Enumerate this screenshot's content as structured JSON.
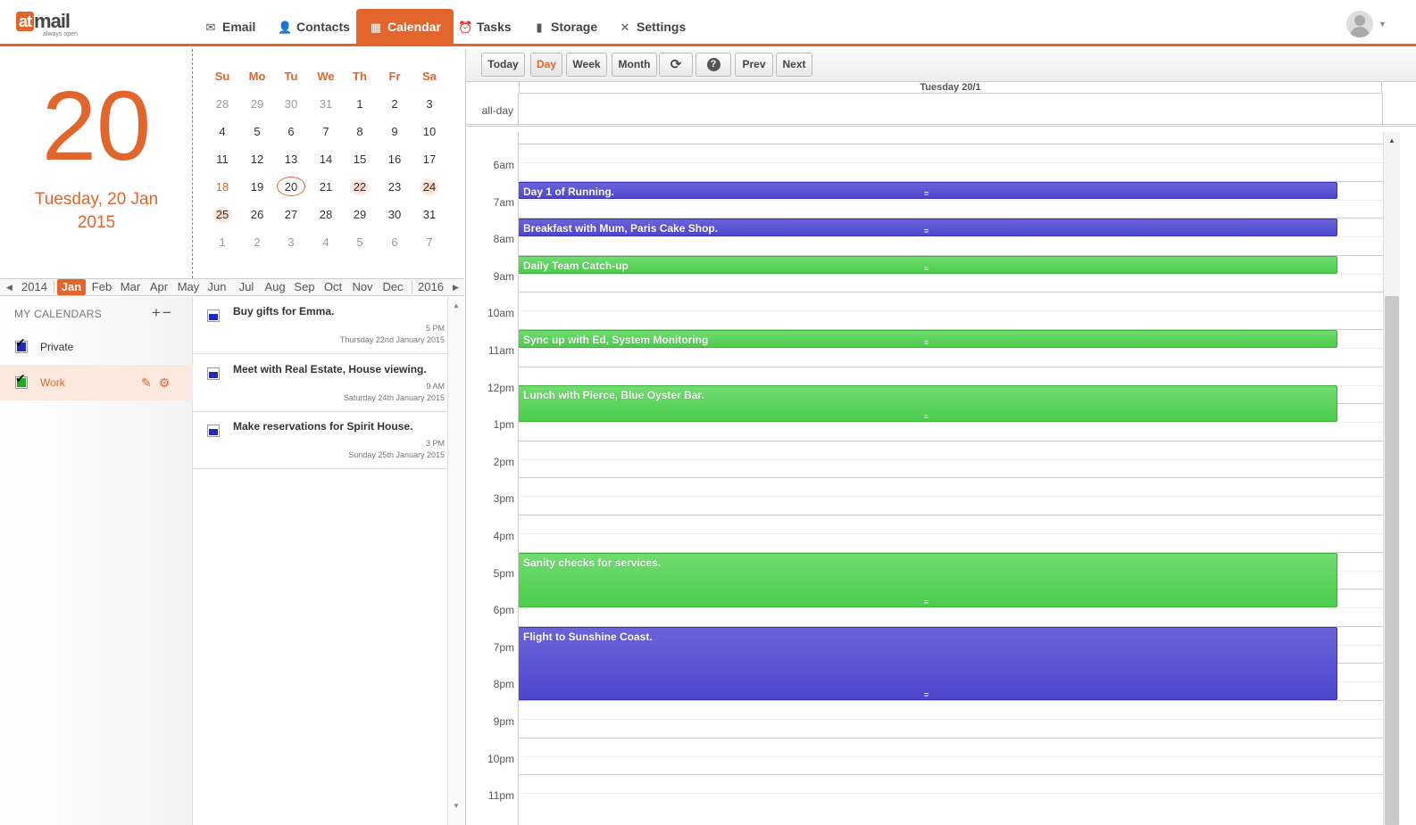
{
  "app": {
    "logo": {
      "at": "at",
      "mail": "mail",
      "tagline": "always open"
    }
  },
  "nav": [
    {
      "label": "Email",
      "icon": "envelope-icon",
      "glyph": "✉"
    },
    {
      "label": "Contacts",
      "icon": "person-icon",
      "glyph": "👤"
    },
    {
      "label": "Calendar",
      "icon": "calendar-icon",
      "glyph": "▦",
      "active": true
    },
    {
      "label": "Tasks",
      "icon": "alarm-clock-icon",
      "glyph": "⏰"
    },
    {
      "label": "Storage",
      "icon": "document-icon",
      "glyph": "▮"
    },
    {
      "label": "Settings",
      "icon": "tools-icon",
      "glyph": "✕"
    }
  ],
  "bigdate": {
    "day": "20",
    "line1": "Tuesday, 20 Jan",
    "line2": "2015"
  },
  "minical": {
    "weekdays": [
      "Su",
      "Mo",
      "Tu",
      "We",
      "Th",
      "Fr",
      "Sa"
    ],
    "weeks": [
      [
        "28",
        "29",
        "30",
        "31",
        "1",
        "2",
        "3"
      ],
      [
        "4",
        "5",
        "6",
        "7",
        "8",
        "9",
        "10"
      ],
      [
        "11",
        "12",
        "13",
        "14",
        "15",
        "16",
        "17"
      ],
      [
        "18",
        "19",
        "20",
        "21",
        "22",
        "23",
        "24"
      ],
      [
        "25",
        "26",
        "27",
        "28",
        "29",
        "30",
        "31"
      ],
      [
        "1",
        "2",
        "3",
        "4",
        "5",
        "6",
        "7"
      ]
    ],
    "today": "20",
    "event_days": [
      "22",
      "24",
      "25"
    ]
  },
  "monthstrip": {
    "prev_year": "2014",
    "next_year": "2016",
    "months": [
      "Jan",
      "Feb",
      "Mar",
      "Apr",
      "May",
      "Jun",
      "Jul",
      "Aug",
      "Sep",
      "Oct",
      "Nov",
      "Dec"
    ],
    "active": "Jan"
  },
  "mycalendars": {
    "title": "MY CALENDARS",
    "add_remove": "+−",
    "items": [
      {
        "name": "Private",
        "color": "#1f2ab8"
      },
      {
        "name": "Work",
        "color": "#22aa22",
        "active": true
      }
    ]
  },
  "tasks": [
    {
      "title": "Buy gifts for Emma.",
      "time": "5 PM",
      "date": "Thursday 22nd January 2015"
    },
    {
      "title": "Meet with Real Estate, House viewing.",
      "time": "9 AM",
      "date": "Saturday 24th January 2015"
    },
    {
      "title": "Make reservations for Spirit House.",
      "time": "3 PM",
      "date": "Sunday 25th January 2015"
    }
  ],
  "toolbar": {
    "today": "Today",
    "day": "Day",
    "week": "Week",
    "month": "Month",
    "refresh": "⟳",
    "help": "?",
    "prev": "Prev",
    "next": "Next"
  },
  "dayview": {
    "header": "Tuesday 20/1",
    "allday": "all-day",
    "hours": [
      "6am",
      "7am",
      "8am",
      "9am",
      "10am",
      "11am",
      "12pm",
      "1pm",
      "2pm",
      "3pm",
      "4pm",
      "5pm",
      "6pm",
      "7pm",
      "8pm",
      "9pm",
      "10pm",
      "11pm"
    ],
    "events": [
      {
        "title": "Day 1 of Running.",
        "start": 7,
        "end": 7.5,
        "color": "blue"
      },
      {
        "title": "Breakfast with Mum, Paris Cake Shop.",
        "start": 8,
        "end": 8.5,
        "color": "blue"
      },
      {
        "title": "Daily Team Catch-up",
        "start": 9,
        "end": 9.5,
        "color": "green"
      },
      {
        "title": "Sync up with Ed, System Monitoring",
        "start": 11,
        "end": 11.5,
        "color": "green"
      },
      {
        "title": "Lunch with Pierce, Blue Oyster Bar.",
        "start": 12.5,
        "end": 13.5,
        "color": "green"
      },
      {
        "title": "Sanity checks for services.",
        "start": 17,
        "end": 18.5,
        "color": "green"
      },
      {
        "title": "Flight to Sunshine Coast.",
        "start": 19,
        "end": 21,
        "color": "blue"
      }
    ]
  }
}
